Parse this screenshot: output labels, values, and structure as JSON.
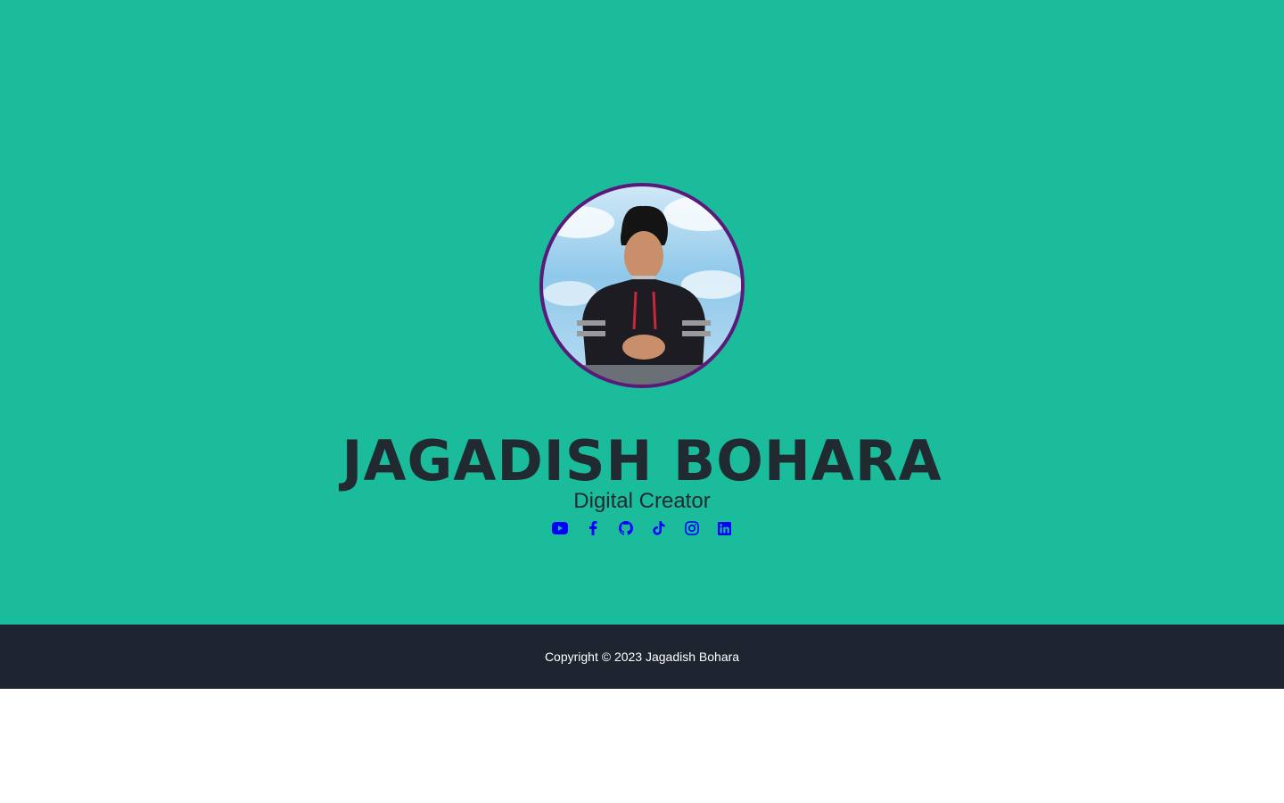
{
  "profile": {
    "name": "JAGADISH BOHARA",
    "title": "Digital Creator"
  },
  "socials": [
    {
      "icon": "youtube-icon"
    },
    {
      "icon": "facebook-icon"
    },
    {
      "icon": "github-icon"
    },
    {
      "icon": "tiktok-icon"
    },
    {
      "icon": "instagram-icon"
    },
    {
      "icon": "linkedin-icon"
    }
  ],
  "footer": {
    "copyright": "Copyright © 2023 Jagadish Bohara"
  },
  "colors": {
    "hero_background": "#1abc9c",
    "footer_background": "#1e2530",
    "avatar_border": "#5b1a7a",
    "icon_color": "#0000ff",
    "heading_color": "#222a31"
  }
}
